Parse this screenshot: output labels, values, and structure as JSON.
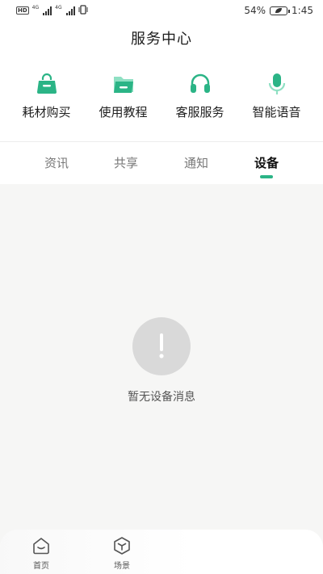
{
  "status_bar": {
    "sim_badge": "HD",
    "net1": "4G",
    "net2": "4G",
    "battery": "54%",
    "time": "1:45"
  },
  "header": {
    "title": "服务中心"
  },
  "services": [
    {
      "label": "耗材购买",
      "icon": "shopping-bag-icon"
    },
    {
      "label": "使用教程",
      "icon": "folder-icon"
    },
    {
      "label": "客服服务",
      "icon": "headphones-icon"
    },
    {
      "label": "智能语音",
      "icon": "microphone-icon"
    }
  ],
  "tabs": [
    {
      "label": "资讯",
      "active": false
    },
    {
      "label": "共享",
      "active": false
    },
    {
      "label": "通知",
      "active": false
    },
    {
      "label": "设备",
      "active": true
    }
  ],
  "empty": {
    "symbol": "!",
    "message": "暂无设备消息"
  },
  "bottom_nav": [
    {
      "label": "首页",
      "icon": "home-icon"
    },
    {
      "label": "场景",
      "icon": "cube-icon"
    }
  ],
  "colors": {
    "accent": "#2bb486",
    "accent_light": "#8fe0c3",
    "background": "#f6f6f5"
  }
}
